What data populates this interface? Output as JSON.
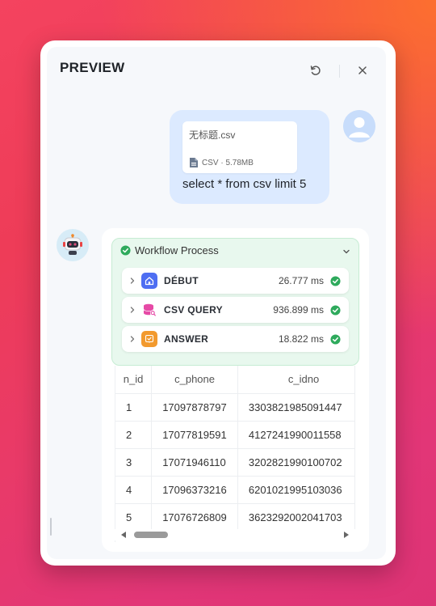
{
  "header": {
    "title": "PREVIEW",
    "refresh_icon": "refresh-icon",
    "close_icon": "close-icon"
  },
  "user_message": {
    "file": {
      "name": "无标题.csv",
      "meta": "CSV · 5.78MB",
      "icon": "file-icon"
    },
    "text": "select * from csv limit 5"
  },
  "workflow": {
    "title": "Workflow Process",
    "steps": [
      {
        "name": "DÉBUT",
        "time": "26.777 ms",
        "icon": "home-icon",
        "color": "#4e6ef2"
      },
      {
        "name": "CSV QUERY",
        "time": "936.899 ms",
        "icon": "database-icon",
        "color": "#e64aa6"
      },
      {
        "name": "ANSWER",
        "time": "18.822 ms",
        "icon": "answer-icon",
        "color": "#f29a2e"
      }
    ]
  },
  "table": {
    "columns": [
      "n_id",
      "c_phone",
      "c_idno"
    ],
    "rows": [
      [
        "1",
        "17097878797",
        "3303821985091447"
      ],
      [
        "2",
        "17077819591",
        "4127241990011558"
      ],
      [
        "3",
        "17071946110",
        "3202821990100702"
      ],
      [
        "4",
        "17096373216",
        "6201021995103036"
      ],
      [
        "5",
        "17076726809",
        "3623292002041703"
      ]
    ]
  },
  "colors": {
    "success": "#2eaa5c",
    "accent": "#4e6ef2"
  }
}
